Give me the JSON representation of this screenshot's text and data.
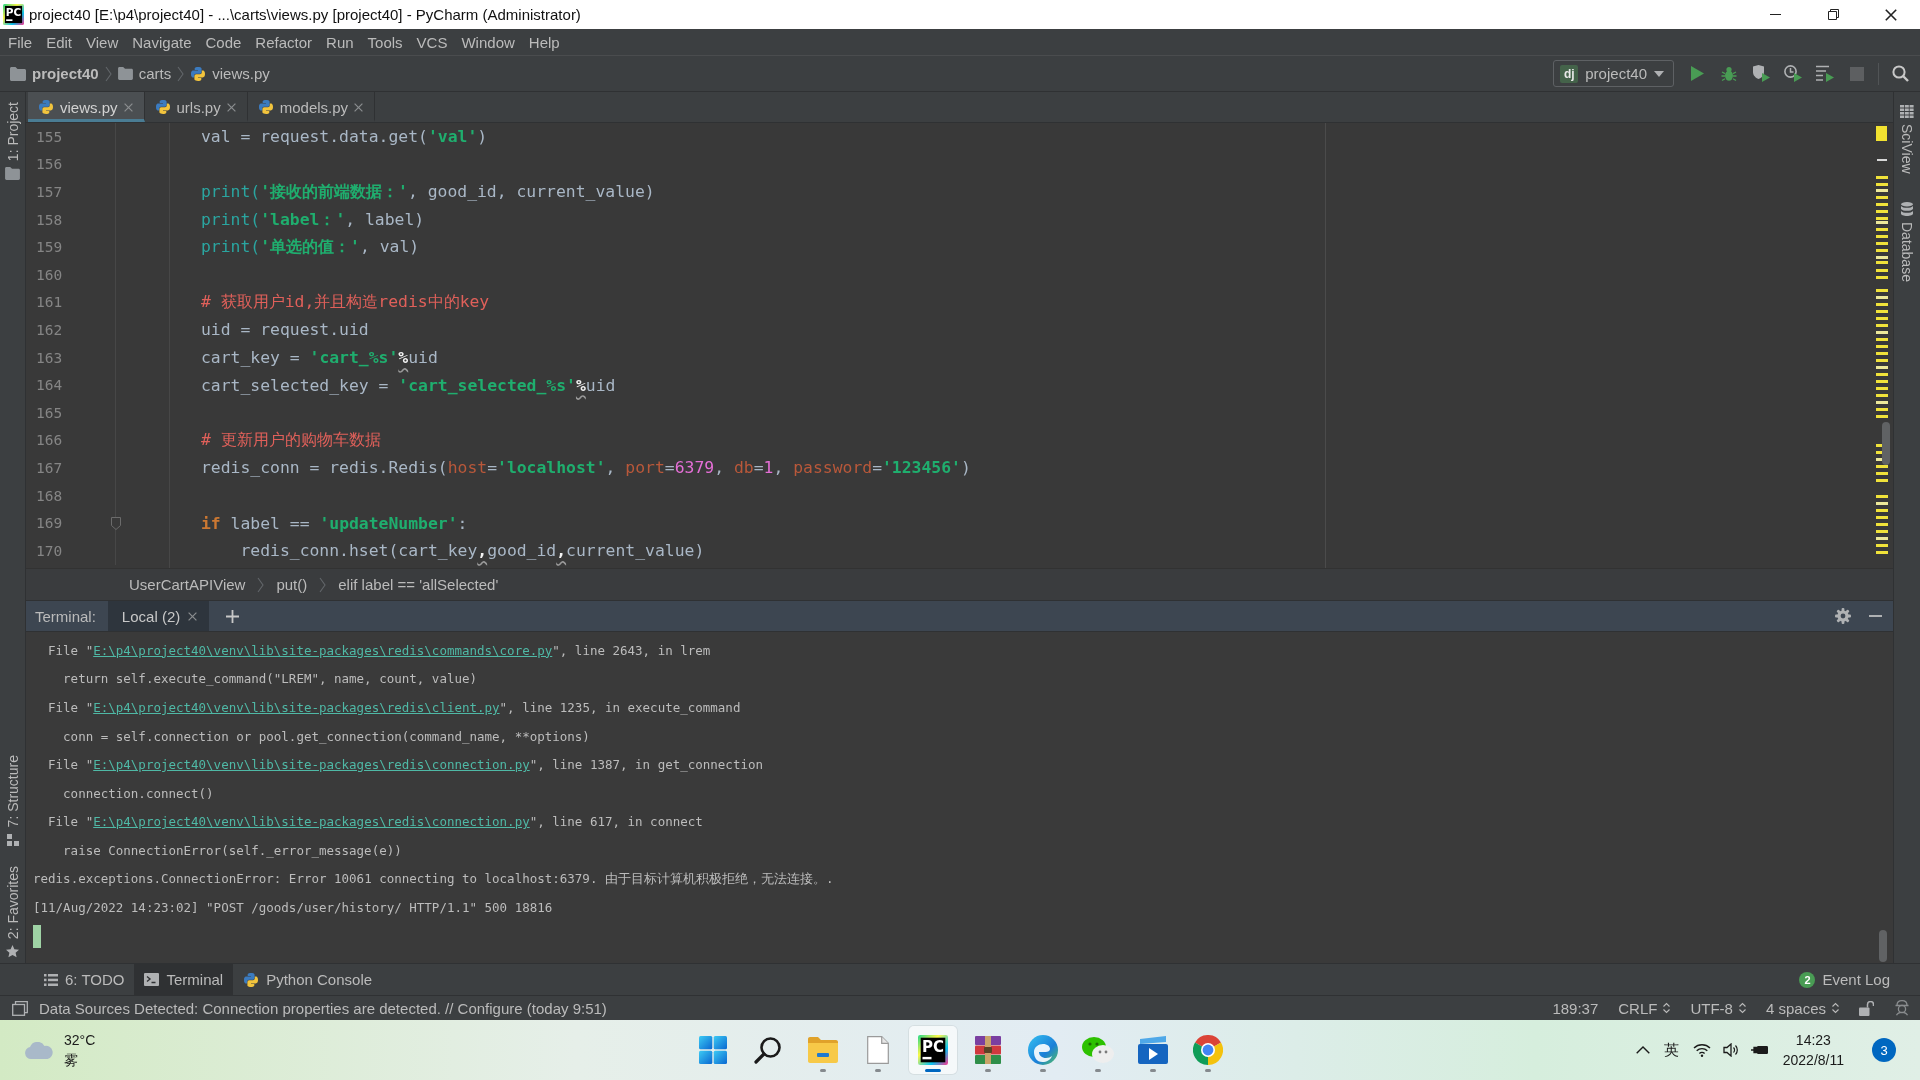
{
  "window": {
    "logo": "PC",
    "title": "project40 [E:\\p4\\project40] - ...\\carts\\views.py [project40] - PyCharm (Administrator)"
  },
  "menu": [
    "File",
    "Edit",
    "View",
    "Navigate",
    "Code",
    "Refactor",
    "Run",
    "Tools",
    "VCS",
    "Window",
    "Help"
  ],
  "breadcrumb": [
    {
      "label": "project40",
      "kind": "project"
    },
    {
      "label": "carts",
      "kind": "folder"
    },
    {
      "label": "views.py",
      "kind": "python"
    }
  ],
  "run_config": {
    "badge": "dj",
    "label": "project40"
  },
  "toolbar_actions": [
    {
      "kind": "run",
      "disabled": false
    },
    {
      "kind": "debug",
      "disabled": false
    },
    {
      "kind": "coverage",
      "disabled": false
    },
    {
      "kind": "profile",
      "disabled": false
    },
    {
      "kind": "concurrency",
      "disabled": false
    },
    {
      "kind": "stop",
      "disabled": true
    }
  ],
  "left_tool_windows": {
    "top": [
      {
        "label": "1: Project",
        "kind": "folder"
      }
    ],
    "bottom": [
      {
        "label": "7: Structure",
        "kind": "structure"
      },
      {
        "label": "2: Favorites",
        "kind": "star"
      }
    ]
  },
  "right_tool_windows": [
    {
      "label": "SciView",
      "kind": "grid"
    },
    {
      "label": "Database",
      "kind": "database"
    }
  ],
  "editor_tabs": [
    {
      "label": "views.py",
      "selected": true
    },
    {
      "label": "urls.py",
      "selected": false
    },
    {
      "label": "models.py",
      "selected": false
    }
  ],
  "editor": {
    "lines": [
      {
        "number": "155",
        "foldable": false,
        "tokens": [
          {
            "text": "        val = request.data.get(",
            "kind": "plain"
          },
          {
            "text": "'val'",
            "kind": "string"
          },
          {
            "text": ")",
            "kind": "plain"
          }
        ]
      },
      {
        "number": "156",
        "foldable": false
      },
      {
        "number": "157",
        "foldable": false,
        "tokens": [
          {
            "text": "        print(",
            "kind": "builtin"
          },
          {
            "text": "'接收的前端数据：'",
            "kind": "string"
          },
          {
            "text": ", good_id, current_value)",
            "kind": "plain"
          }
        ]
      },
      {
        "number": "158",
        "foldable": false,
        "tokens": [
          {
            "text": "        print(",
            "kind": "builtin"
          },
          {
            "text": "'label：'",
            "kind": "string"
          },
          {
            "text": ", label)",
            "kind": "plain"
          }
        ]
      },
      {
        "number": "159",
        "foldable": false,
        "tokens": [
          {
            "text": "        print(",
            "kind": "builtin"
          },
          {
            "text": "'单选的值：'",
            "kind": "string"
          },
          {
            "text": ", val)",
            "kind": "plain"
          }
        ]
      },
      {
        "number": "160",
        "foldable": false
      },
      {
        "number": "161",
        "foldable": false,
        "tokens": [
          {
            "text": "        # 获取用户id,并且构造redis中的key",
            "kind": "comment"
          }
        ]
      },
      {
        "number": "162",
        "foldable": false,
        "tokens": [
          {
            "text": "        uid = request.uid",
            "kind": "plain"
          }
        ]
      },
      {
        "number": "163",
        "foldable": false,
        "tokens": [
          {
            "text": "        cart_key = ",
            "kind": "plain"
          },
          {
            "text": "'cart_%s'",
            "kind": "string"
          },
          {
            "text": "%",
            "kind": "warning"
          },
          {
            "text": "uid",
            "kind": "plain"
          }
        ]
      },
      {
        "number": "164",
        "foldable": false,
        "tokens": [
          {
            "text": "        cart_selected_key = ",
            "kind": "plain"
          },
          {
            "text": "'cart_selected_%s'",
            "kind": "string"
          },
          {
            "text": "%",
            "kind": "warning"
          },
          {
            "text": "uid",
            "kind": "plain"
          }
        ]
      },
      {
        "number": "165",
        "foldable": false
      },
      {
        "number": "166",
        "foldable": false,
        "tokens": [
          {
            "text": "        # 更新用户的购物车数据",
            "kind": "comment"
          }
        ]
      },
      {
        "number": "167",
        "foldable": false,
        "tokens": [
          {
            "text": "        redis_conn = redis.Redis(",
            "kind": "plain"
          },
          {
            "text": "host",
            "kind": "param"
          },
          {
            "text": "=",
            "kind": "plain"
          },
          {
            "text": "'localhost'",
            "kind": "string"
          },
          {
            "text": ", ",
            "kind": "plain"
          },
          {
            "text": "port",
            "kind": "param"
          },
          {
            "text": "=",
            "kind": "plain"
          },
          {
            "text": "6379",
            "kind": "number"
          },
          {
            "text": ", ",
            "kind": "plain"
          },
          {
            "text": "db",
            "kind": "param"
          },
          {
            "text": "=",
            "kind": "plain"
          },
          {
            "text": "1",
            "kind": "number"
          },
          {
            "text": ", ",
            "kind": "plain"
          },
          {
            "text": "password",
            "kind": "param"
          },
          {
            "text": "=",
            "kind": "plain"
          },
          {
            "text": "'123456'",
            "kind": "string"
          },
          {
            "text": ")",
            "kind": "plain"
          }
        ]
      },
      {
        "number": "168",
        "foldable": false
      },
      {
        "number": "169",
        "foldable": true,
        "tokens": [
          {
            "text": "        if",
            "kind": "keyword"
          },
          {
            "text": " label == ",
            "kind": "plain"
          },
          {
            "text": "'updateNumber'",
            "kind": "string"
          },
          {
            "text": ":",
            "kind": "plain"
          }
        ]
      },
      {
        "number": "170",
        "foldable": false,
        "tokens": [
          {
            "text": "            redis_conn.hset(cart_key",
            "kind": "plain"
          },
          {
            "text": ",",
            "kind": "warning"
          },
          {
            "text": "good_id",
            "kind": "plain"
          },
          {
            "text": ",",
            "kind": "warning"
          },
          {
            "text": "current_value)",
            "kind": "plain"
          }
        ]
      }
    ]
  },
  "editor_breadcrumb": [
    "UserCartAPIView",
    "put()",
    "elif label == 'allSelected'"
  ],
  "terminal": {
    "title": "Terminal:",
    "tabs": [
      {
        "label": "Local (2)",
        "selected": true
      }
    ],
    "lines": [
      {
        "kind": "file",
        "text": "File \"",
        "link": "E:\\p4\\project40\\venv\\lib\\site-packages\\redis\\commands\\core.py",
        "tail": "\", line 2643, in lrem"
      },
      {
        "kind": "source",
        "text": "return self.execute_command(\"LREM\", name, count, value)"
      },
      {
        "kind": "file",
        "text": "File \"",
        "link": "E:\\p4\\project40\\venv\\lib\\site-packages\\redis\\client.py",
        "tail": "\", line 1235, in execute_command"
      },
      {
        "kind": "source",
        "text": "conn = self.connection or pool.get_connection(command_name, **options)"
      },
      {
        "kind": "file",
        "text": "File \"",
        "link": "E:\\p4\\project40\\venv\\lib\\site-packages\\redis\\connection.py",
        "tail": "\", line 1387, in get_connection"
      },
      {
        "kind": "source",
        "text": "connection.connect()"
      },
      {
        "kind": "file",
        "text": "File \"",
        "link": "E:\\p4\\project40\\venv\\lib\\site-packages\\redis\\connection.py",
        "tail": "\", line 617, in connect"
      },
      {
        "kind": "source",
        "text": "raise ConnectionError(self._error_message(e))"
      },
      {
        "kind": "error",
        "text": "redis.exceptions.ConnectionError: Error 10061 connecting to localhost:6379. 由于目标计算机积极拒绝，无法连接。."
      },
      {
        "kind": "log",
        "text": "[11/Aug/2022 14:23:02] \"POST /goods/user/history/ HTTP/1.1\" 500 18816"
      }
    ]
  },
  "tool_tabs": [
    {
      "label": "6: TODO",
      "kind": "list",
      "selected": false
    },
    {
      "label": "Terminal",
      "kind": "terminal",
      "selected": true
    },
    {
      "label": "Python Console",
      "kind": "python",
      "selected": false
    }
  ],
  "event_log": {
    "count": "2",
    "label": "Event Log"
  },
  "status_bar": {
    "message": "Data Sources Detected: Connection properties are detected. // Configure (today 9:51)",
    "widgets": [
      {
        "text": "189:37",
        "kind": "text"
      },
      {
        "text": "CRLF",
        "kind": "select"
      },
      {
        "text": "UTF-8",
        "kind": "select"
      },
      {
        "text": "4 spaces",
        "kind": "select"
      }
    ]
  },
  "taskbar": {
    "weather": {
      "temperature": "32°C",
      "condition": "雾"
    },
    "apps": [
      {
        "kind": "start",
        "running": false,
        "selected": false
      },
      {
        "kind": "search",
        "running": false,
        "selected": false
      },
      {
        "kind": "folder",
        "running": true,
        "selected": false
      },
      {
        "kind": "page",
        "running": true,
        "selected": false
      },
      {
        "kind": "ide",
        "logo": "PC",
        "running": true,
        "selected": true
      },
      {
        "kind": "archive",
        "running": true,
        "selected": false
      },
      {
        "kind": "swirl",
        "running": true,
        "selected": false
      },
      {
        "kind": "chat",
        "running": true,
        "selected": false
      },
      {
        "kind": "video",
        "running": true,
        "selected": false
      },
      {
        "kind": "ring",
        "running": true,
        "selected": false
      }
    ],
    "tray": {
      "ime": "英",
      "time": "14:23",
      "date": "2022/8/11",
      "notifications": "3"
    }
  }
}
